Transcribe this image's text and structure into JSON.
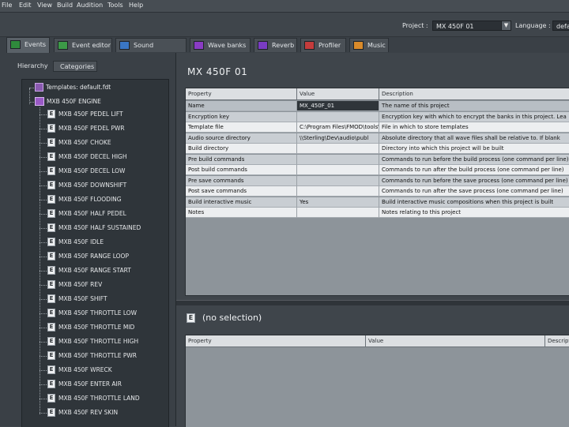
{
  "menu": [
    "File",
    "Edit",
    "View",
    "Build",
    "Audition",
    "Tools",
    "Help"
  ],
  "project_bar": {
    "project_label": "Project :",
    "project_value": "MX 450F 01",
    "language_label": "Language :",
    "language_value": "defa"
  },
  "tabs": [
    "Events",
    "Event editor",
    "Sound definitions",
    "Wave banks",
    "Reverb",
    "Profiler",
    "Music"
  ],
  "left": {
    "hierarchy_tab": "Hierarchy",
    "categories_tab": "Categories",
    "templates_label": "Templates: default.fdt",
    "group_label": "MXB 450F ENGINE",
    "events": [
      "MXB 450F PEDEL LIFT",
      "MXB 450F PEDEL PWR",
      "MXB 450F CHOKE",
      "MXB 450F DECEL HIGH",
      "MXB 450F DECEL LOW",
      "MXB 450F DOWNSHIFT",
      "MXB 450F FLOODING",
      "MXB 450F HALF PEDEL",
      "MXB 450F HALF SUSTAINED",
      "MXB 450F IDLE",
      "MXB 450F RANGE LOOP",
      "MXB 450F RANGE START",
      "MXB 450F REV",
      "MXB 450F SHIFT",
      "MXB 450F THROTTLE LOW",
      "MXB 450F THROTTLE MID",
      "MXB 450F THROTTLE HIGH",
      "MXB 450F THROTTLE PWR",
      "MXB 450F WRECK",
      "MXB 450F ENTER AIR",
      "MXB 450F THROTTLE LAND",
      "MXB 450F REV SKIN"
    ]
  },
  "main": {
    "project_title": "MX 450F 01",
    "grid_headers": [
      "Property",
      "Value",
      "Description"
    ],
    "rows": [
      {
        "property": "Name",
        "value": "MX_450F_01",
        "description": "The name of this project",
        "selected": true
      },
      {
        "property": "Encryption key",
        "value": "",
        "description": "Encryption key with which to encrypt the banks in this project. Lea"
      },
      {
        "property": "Template file",
        "value": "C:\\Program Files\\FMOD\\tools\\...",
        "description": "File in which to store templates"
      },
      {
        "property": "Audio source directory",
        "value": "\\\\Sterling\\Dev\\audio\\publ",
        "description": "Absolute directory that all wave files shall be relative to. If blank"
      },
      {
        "property": "Build directory",
        "value": "",
        "description": "Directory into which this project will be built"
      },
      {
        "property": "Pre build commands",
        "value": "",
        "description": "Commands to run before the build process (one command per line)"
      },
      {
        "property": "Post build commands",
        "value": "",
        "description": "Commands to run after the build process (one command per line)"
      },
      {
        "property": "Pre save commands",
        "value": "",
        "description": "Commands to run before the save process (one command per line)"
      },
      {
        "property": "Post save commands",
        "value": "",
        "description": "Commands to run after the save process (one command per line)"
      },
      {
        "property": "Build interactive music",
        "value": "Yes",
        "description": "Build interactive music compositions when this project is built"
      },
      {
        "property": "Notes",
        "value": "",
        "description": "Notes relating to this project"
      }
    ],
    "selection_title": "(no selection)",
    "grid2_headers": [
      "Property",
      "Value",
      "Descript"
    ]
  },
  "colors": {
    "window_bg": "#3f454b",
    "tree_bg": "#2f353a",
    "grid_row_light": "#eceef0",
    "grid_row_dark": "#c9ced3",
    "selected_row": "#b8bec4",
    "selected_cell": "#2f353a"
  }
}
